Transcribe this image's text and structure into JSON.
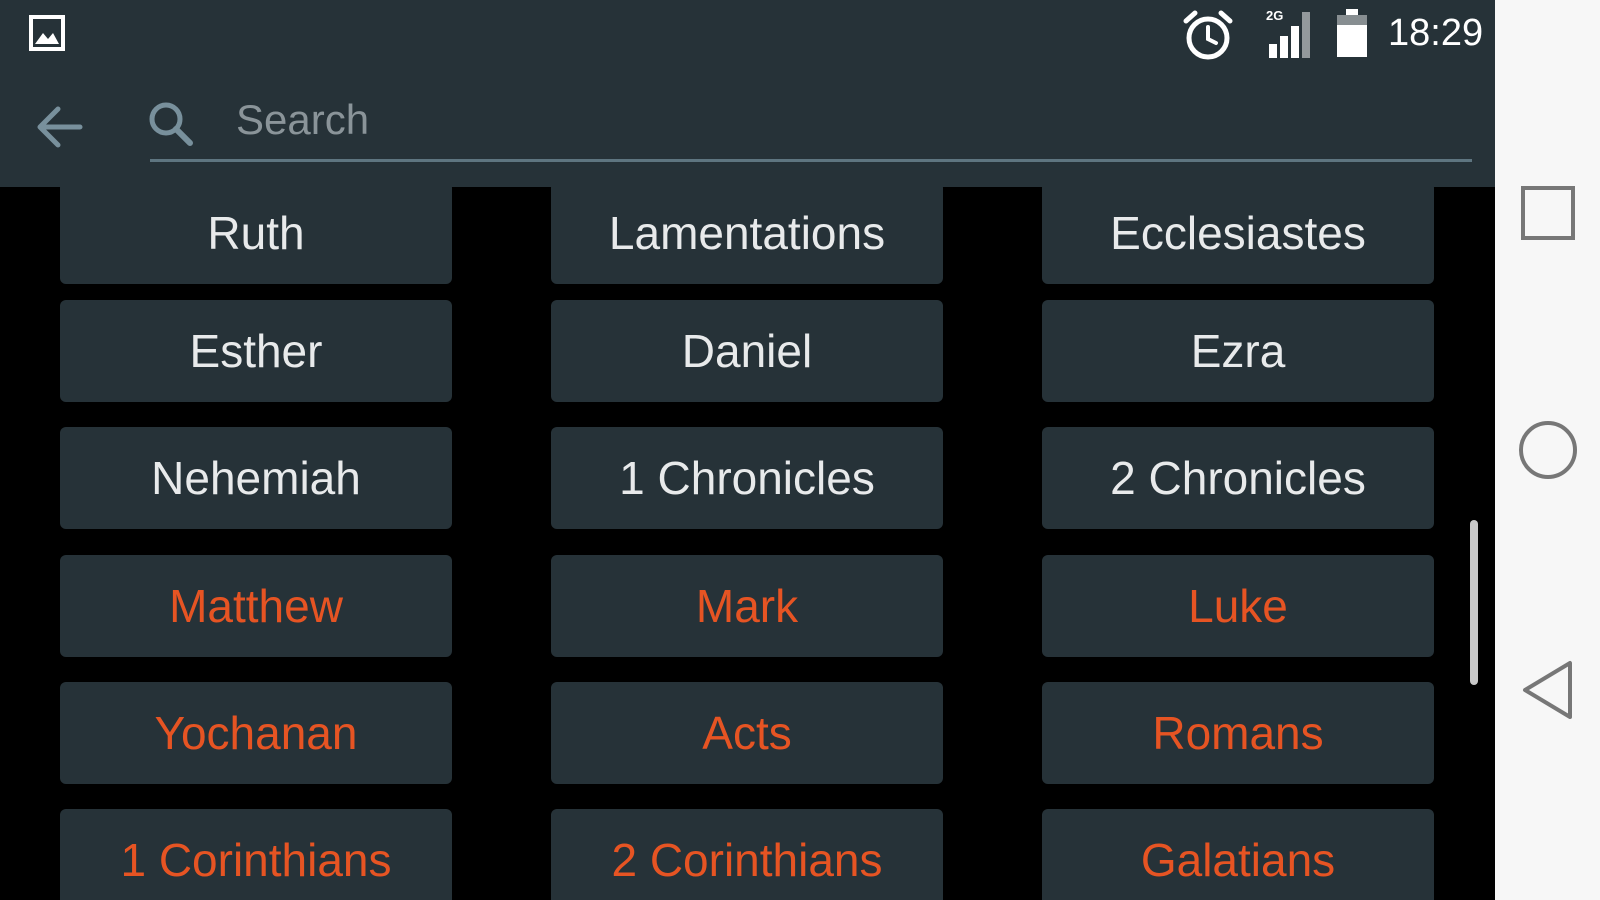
{
  "status_bar": {
    "time": "18:29",
    "network_type": "2G",
    "icons": [
      "gallery-icon",
      "alarm-icon",
      "signal-icon",
      "battery-icon"
    ]
  },
  "search": {
    "placeholder": "Search",
    "value": ""
  },
  "colors": {
    "bar_background": "#263238",
    "button_background": "#263238",
    "old_testament_text": "#e8eaeb",
    "new_testament_text": "#e65423",
    "grid_background": "#000000",
    "nav_bar_background": "#f7f7f7"
  },
  "books": [
    {
      "label": "Ruth",
      "testament": "old"
    },
    {
      "label": "Lamentations",
      "testament": "old"
    },
    {
      "label": "Ecclesiastes",
      "testament": "old"
    },
    {
      "label": "Esther",
      "testament": "old"
    },
    {
      "label": "Daniel",
      "testament": "old"
    },
    {
      "label": "Ezra",
      "testament": "old"
    },
    {
      "label": "Nehemiah",
      "testament": "old"
    },
    {
      "label": "1 Chronicles",
      "testament": "old"
    },
    {
      "label": "2 Chronicles",
      "testament": "old"
    },
    {
      "label": "Matthew",
      "testament": "new"
    },
    {
      "label": "Mark",
      "testament": "new"
    },
    {
      "label": "Luke",
      "testament": "new"
    },
    {
      "label": "Yochanan",
      "testament": "new"
    },
    {
      "label": "Acts",
      "testament": "new"
    },
    {
      "label": "Romans",
      "testament": "new"
    },
    {
      "label": "1 Corinthians",
      "testament": "new"
    },
    {
      "label": "2 Corinthians",
      "testament": "new"
    },
    {
      "label": "Galatians",
      "testament": "new"
    }
  ],
  "nav_bar": {
    "buttons": [
      "recent-apps-button",
      "home-button",
      "back-nav-button"
    ]
  }
}
